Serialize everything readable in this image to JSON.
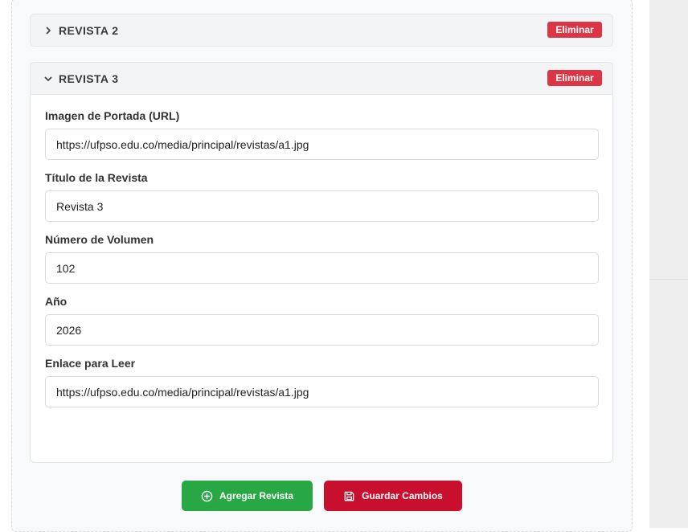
{
  "magazines": [
    {
      "title": "REVISTA 2",
      "delete_label": "Eliminar",
      "expanded": false
    },
    {
      "title": "REVISTA 3",
      "delete_label": "Eliminar",
      "expanded": true
    }
  ],
  "form": {
    "cover_image": {
      "label": "Imagen de Portada (URL)",
      "value": "https://ufpso.edu.co/media/principal/revistas/a1.jpg"
    },
    "magazine_title": {
      "label": "Título de la Revista",
      "value": "Revista 3"
    },
    "volume_number": {
      "label": "Número de Volumen",
      "value": "102"
    },
    "year": {
      "label": "Año",
      "value": "2026"
    },
    "read_link": {
      "label": "Enlace para Leer",
      "value": "https://ufpso.edu.co/media/principal/revistas/a1.jpg"
    }
  },
  "actions": {
    "add_label": "Agregar Revista",
    "save_label": "Guardar Cambios"
  },
  "colors": {
    "delete": "#dc3545",
    "add": "#28a745",
    "save": "#c8102e"
  },
  "icons": {
    "collapsed": "chevron-right-icon",
    "expanded": "chevron-down-icon",
    "add": "plus-circle-icon",
    "save": "floppy-disk-icon"
  }
}
